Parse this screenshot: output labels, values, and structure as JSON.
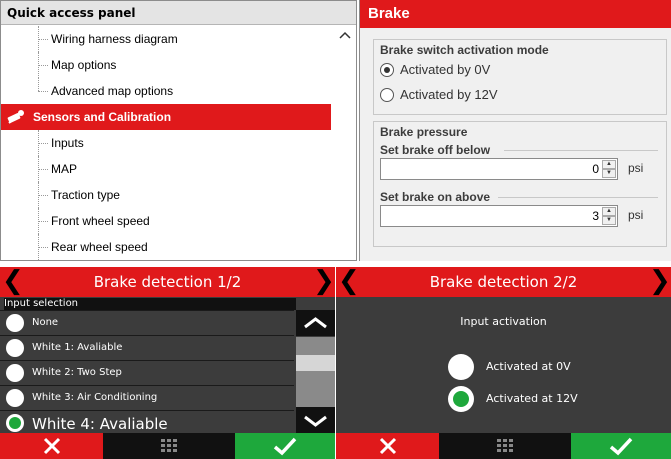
{
  "quick_access": {
    "title": "Quick access panel",
    "items": [
      {
        "label": "Wiring harness diagram"
      },
      {
        "label": "Map options"
      },
      {
        "label": "Advanced map options"
      }
    ],
    "category": "Sensors and Calibration",
    "category_items": [
      {
        "label": "Inputs"
      },
      {
        "label": "MAP"
      },
      {
        "label": "Traction type"
      },
      {
        "label": "Front wheel speed"
      },
      {
        "label": "Rear wheel speed"
      }
    ]
  },
  "brake": {
    "title": "Brake",
    "switch_group": {
      "title": "Brake switch activation mode",
      "options": [
        {
          "label": "Activated by 0V",
          "selected": true
        },
        {
          "label": "Activated by 12V",
          "selected": false
        }
      ]
    },
    "pressure_group": {
      "title": "Brake pressure",
      "off_label": "Set brake off below",
      "off_value": "0",
      "on_label": "Set brake on above",
      "on_value": "3",
      "unit": "psi"
    }
  },
  "screen1": {
    "title": "Brake detection 1/2",
    "prev": "❮",
    "next": "❯",
    "section_label": "Input selection",
    "options": [
      {
        "label": "None"
      },
      {
        "label": "White 1: Avaliable"
      },
      {
        "label": "White 2: Two Step"
      },
      {
        "label": "White 3: Air Conditioning"
      },
      {
        "label": "White 4: Avaliable"
      }
    ]
  },
  "screen2": {
    "title": "Brake detection 2/2",
    "prev": "❮",
    "next": "❯",
    "section_label": "Input activation",
    "options": [
      {
        "label": "Activated at 0V",
        "selected": false
      },
      {
        "label": "Activated at 12V",
        "selected": true
      }
    ]
  },
  "colors": {
    "accent_red": "#e0191b",
    "ok_green": "#1ea83c",
    "screen_bg": "#3c3c3c"
  },
  "icons": {
    "category": "sensor-calibration-icon",
    "cancel": "close-icon",
    "menu": "grid-menu-icon",
    "ok": "checkmark-icon"
  }
}
